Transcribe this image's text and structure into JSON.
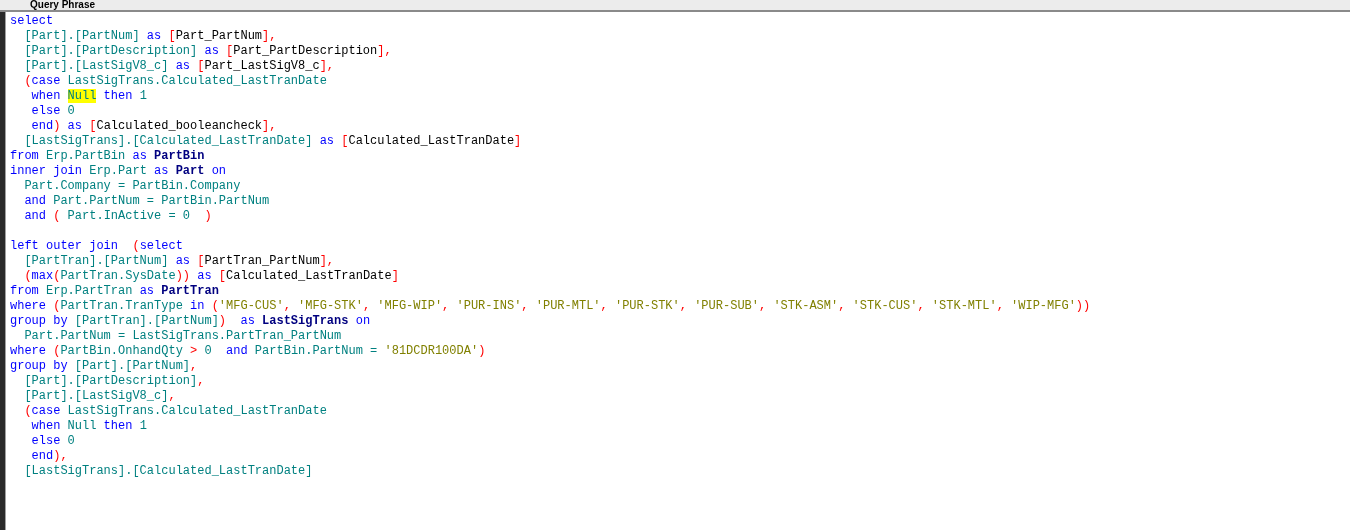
{
  "panel": {
    "title": "Query Phrase"
  },
  "editor": {
    "lines": [
      {
        "segments": [
          {
            "kind": "kw",
            "text": "select"
          }
        ]
      },
      {
        "segments": [
          {
            "kind": "id",
            "text": "  [Part].[PartNum] "
          },
          {
            "kind": "kw",
            "text": "as"
          },
          {
            "kind": "op",
            "text": " ["
          },
          {
            "kind": "alias",
            "text": "Part_PartNum"
          },
          {
            "kind": "op",
            "text": "],"
          }
        ]
      },
      {
        "segments": [
          {
            "kind": "id",
            "text": "  [Part].[PartDescription] "
          },
          {
            "kind": "kw",
            "text": "as"
          },
          {
            "kind": "op",
            "text": " ["
          },
          {
            "kind": "alias",
            "text": "Part_PartDescription"
          },
          {
            "kind": "op",
            "text": "],"
          }
        ]
      },
      {
        "segments": [
          {
            "kind": "id",
            "text": "  [Part].[LastSigV8_c] "
          },
          {
            "kind": "kw",
            "text": "as"
          },
          {
            "kind": "op",
            "text": " ["
          },
          {
            "kind": "alias",
            "text": "Part_LastSigV8_c"
          },
          {
            "kind": "op",
            "text": "],"
          }
        ]
      },
      {
        "segments": [
          {
            "kind": "op",
            "text": "  ("
          },
          {
            "kind": "kw",
            "text": "case"
          },
          {
            "kind": "id",
            "text": " LastSigTrans.Calculated_LastTranDate"
          }
        ]
      },
      {
        "segments": [
          {
            "kind": "kw",
            "text": "   when "
          },
          {
            "kind": "highlight",
            "text": "Null"
          },
          {
            "kind": "kw",
            "text": " then"
          },
          {
            "kind": "id",
            "text": " 1"
          }
        ]
      },
      {
        "segments": [
          {
            "kind": "kw",
            "text": "   else"
          },
          {
            "kind": "id",
            "text": " 0"
          }
        ]
      },
      {
        "segments": [
          {
            "kind": "kw",
            "text": "   end"
          },
          {
            "kind": "op",
            "text": ")"
          },
          {
            "kind": "kw",
            "text": " as"
          },
          {
            "kind": "op",
            "text": " ["
          },
          {
            "kind": "alias",
            "text": "Calculated_booleancheck"
          },
          {
            "kind": "op",
            "text": "],"
          }
        ]
      },
      {
        "segments": [
          {
            "kind": "id",
            "text": "  [LastSigTrans].[Calculated_LastTranDate] "
          },
          {
            "kind": "kw",
            "text": "as"
          },
          {
            "kind": "op",
            "text": " ["
          },
          {
            "kind": "alias",
            "text": "Calculated_LastTranDate"
          },
          {
            "kind": "op",
            "text": "]"
          }
        ]
      },
      {
        "segments": [
          {
            "kind": "kw",
            "text": "from"
          },
          {
            "kind": "id",
            "text": " Erp.PartBin "
          },
          {
            "kind": "kw",
            "text": "as"
          },
          {
            "kind": "table",
            "text": " PartBin"
          }
        ]
      },
      {
        "segments": [
          {
            "kind": "kw",
            "text": "inner join"
          },
          {
            "kind": "id",
            "text": " Erp.Part "
          },
          {
            "kind": "kw",
            "text": "as"
          },
          {
            "kind": "table",
            "text": " Part"
          },
          {
            "kind": "kw",
            "text": " on"
          }
        ]
      },
      {
        "segments": [
          {
            "kind": "id",
            "text": "  Part.Company = PartBin.Company"
          }
        ]
      },
      {
        "segments": [
          {
            "kind": "kw",
            "text": "  and"
          },
          {
            "kind": "id",
            "text": " Part.PartNum = PartBin.PartNum"
          }
        ]
      },
      {
        "segments": [
          {
            "kind": "kw",
            "text": "  and"
          },
          {
            "kind": "op",
            "text": " ("
          },
          {
            "kind": "id",
            "text": " Part.InActive = 0  "
          },
          {
            "kind": "op",
            "text": ")"
          }
        ]
      },
      {
        "gap_before": true,
        "segments": [
          {
            "kind": "kw",
            "text": "left outer join"
          },
          {
            "kind": "op",
            "text": "  ("
          },
          {
            "kind": "kw",
            "text": "select"
          }
        ]
      },
      {
        "segments": [
          {
            "kind": "id",
            "text": "  [PartTran].[PartNum] "
          },
          {
            "kind": "kw",
            "text": "as"
          },
          {
            "kind": "op",
            "text": " ["
          },
          {
            "kind": "alias",
            "text": "PartTran_PartNum"
          },
          {
            "kind": "op",
            "text": "],"
          }
        ]
      },
      {
        "segments": [
          {
            "kind": "op",
            "text": "  ("
          },
          {
            "kind": "kw",
            "text": "max"
          },
          {
            "kind": "op",
            "text": "("
          },
          {
            "kind": "id",
            "text": "PartTran.SysDate"
          },
          {
            "kind": "op",
            "text": "))"
          },
          {
            "kind": "kw",
            "text": " as"
          },
          {
            "kind": "op",
            "text": " ["
          },
          {
            "kind": "alias",
            "text": "Calculated_LastTranDate"
          },
          {
            "kind": "op",
            "text": "]"
          }
        ]
      },
      {
        "segments": [
          {
            "kind": "kw",
            "text": "from"
          },
          {
            "kind": "id",
            "text": " Erp.PartTran "
          },
          {
            "kind": "kw",
            "text": "as"
          },
          {
            "kind": "table",
            "text": " PartTran"
          }
        ]
      },
      {
        "segments": [
          {
            "kind": "kw",
            "text": "where"
          },
          {
            "kind": "op",
            "text": " ("
          },
          {
            "kind": "id",
            "text": "PartTran.TranType "
          },
          {
            "kind": "kw",
            "text": "in"
          },
          {
            "kind": "op",
            "text": " ("
          },
          {
            "kind": "str",
            "text": "'MFG-CUS'"
          },
          {
            "kind": "op",
            "text": ", "
          },
          {
            "kind": "str",
            "text": "'MFG-STK'"
          },
          {
            "kind": "op",
            "text": ", "
          },
          {
            "kind": "str",
            "text": "'MFG-WIP'"
          },
          {
            "kind": "op",
            "text": ", "
          },
          {
            "kind": "str",
            "text": "'PUR-INS'"
          },
          {
            "kind": "op",
            "text": ", "
          },
          {
            "kind": "str",
            "text": "'PUR-MTL'"
          },
          {
            "kind": "op",
            "text": ", "
          },
          {
            "kind": "str",
            "text": "'PUR-STK'"
          },
          {
            "kind": "op",
            "text": ", "
          },
          {
            "kind": "str",
            "text": "'PUR-SUB'"
          },
          {
            "kind": "op",
            "text": ", "
          },
          {
            "kind": "str",
            "text": "'STK-ASM'"
          },
          {
            "kind": "op",
            "text": ", "
          },
          {
            "kind": "str",
            "text": "'STK-CUS'"
          },
          {
            "kind": "op",
            "text": ", "
          },
          {
            "kind": "str",
            "text": "'STK-MTL'"
          },
          {
            "kind": "op",
            "text": ", "
          },
          {
            "kind": "str",
            "text": "'WIP-MFG'"
          },
          {
            "kind": "op",
            "text": "))"
          }
        ]
      },
      {
        "segments": [
          {
            "kind": "kw",
            "text": "group by"
          },
          {
            "kind": "id",
            "text": " [PartTran].[PartNum]"
          },
          {
            "kind": "op",
            "text": ")"
          },
          {
            "kind": "kw",
            "text": "  as"
          },
          {
            "kind": "table",
            "text": " LastSigTrans"
          },
          {
            "kind": "kw",
            "text": " on"
          }
        ]
      },
      {
        "segments": [
          {
            "kind": "id",
            "text": "  Part.PartNum = LastSigTrans.PartTran_PartNum"
          }
        ]
      },
      {
        "segments": [
          {
            "kind": "kw",
            "text": "where"
          },
          {
            "kind": "op",
            "text": " ("
          },
          {
            "kind": "id",
            "text": "PartBin.OnhandQty "
          },
          {
            "kind": "op",
            "text": ">"
          },
          {
            "kind": "id",
            "text": " 0  "
          },
          {
            "kind": "kw",
            "text": "and"
          },
          {
            "kind": "id",
            "text": " PartBin.PartNum = "
          },
          {
            "kind": "str",
            "text": "'81DCDR100DA'"
          },
          {
            "kind": "op",
            "text": ")"
          }
        ]
      },
      {
        "segments": [
          {
            "kind": "kw",
            "text": "group by"
          },
          {
            "kind": "id",
            "text": " [Part].[PartNum]"
          },
          {
            "kind": "op",
            "text": ","
          }
        ]
      },
      {
        "segments": [
          {
            "kind": "id",
            "text": "  [Part].[PartDescription]"
          },
          {
            "kind": "op",
            "text": ","
          }
        ]
      },
      {
        "segments": [
          {
            "kind": "id",
            "text": "  [Part].[LastSigV8_c]"
          },
          {
            "kind": "op",
            "text": ","
          }
        ]
      },
      {
        "segments": [
          {
            "kind": "op",
            "text": "  ("
          },
          {
            "kind": "kw",
            "text": "case"
          },
          {
            "kind": "id",
            "text": " LastSigTrans.Calculated_LastTranDate"
          }
        ]
      },
      {
        "segments": [
          {
            "kind": "kw",
            "text": "   when "
          },
          {
            "kind": "id",
            "text": "Null"
          },
          {
            "kind": "kw",
            "text": " then"
          },
          {
            "kind": "id",
            "text": " 1"
          }
        ]
      },
      {
        "segments": [
          {
            "kind": "kw",
            "text": "   else"
          },
          {
            "kind": "id",
            "text": " 0"
          }
        ]
      },
      {
        "segments": [
          {
            "kind": "kw",
            "text": "   end"
          },
          {
            "kind": "op",
            "text": "),"
          }
        ]
      },
      {
        "segments": [
          {
            "kind": "id",
            "text": "  [LastSigTrans].[Calculated_LastTranDate]"
          }
        ]
      }
    ]
  }
}
